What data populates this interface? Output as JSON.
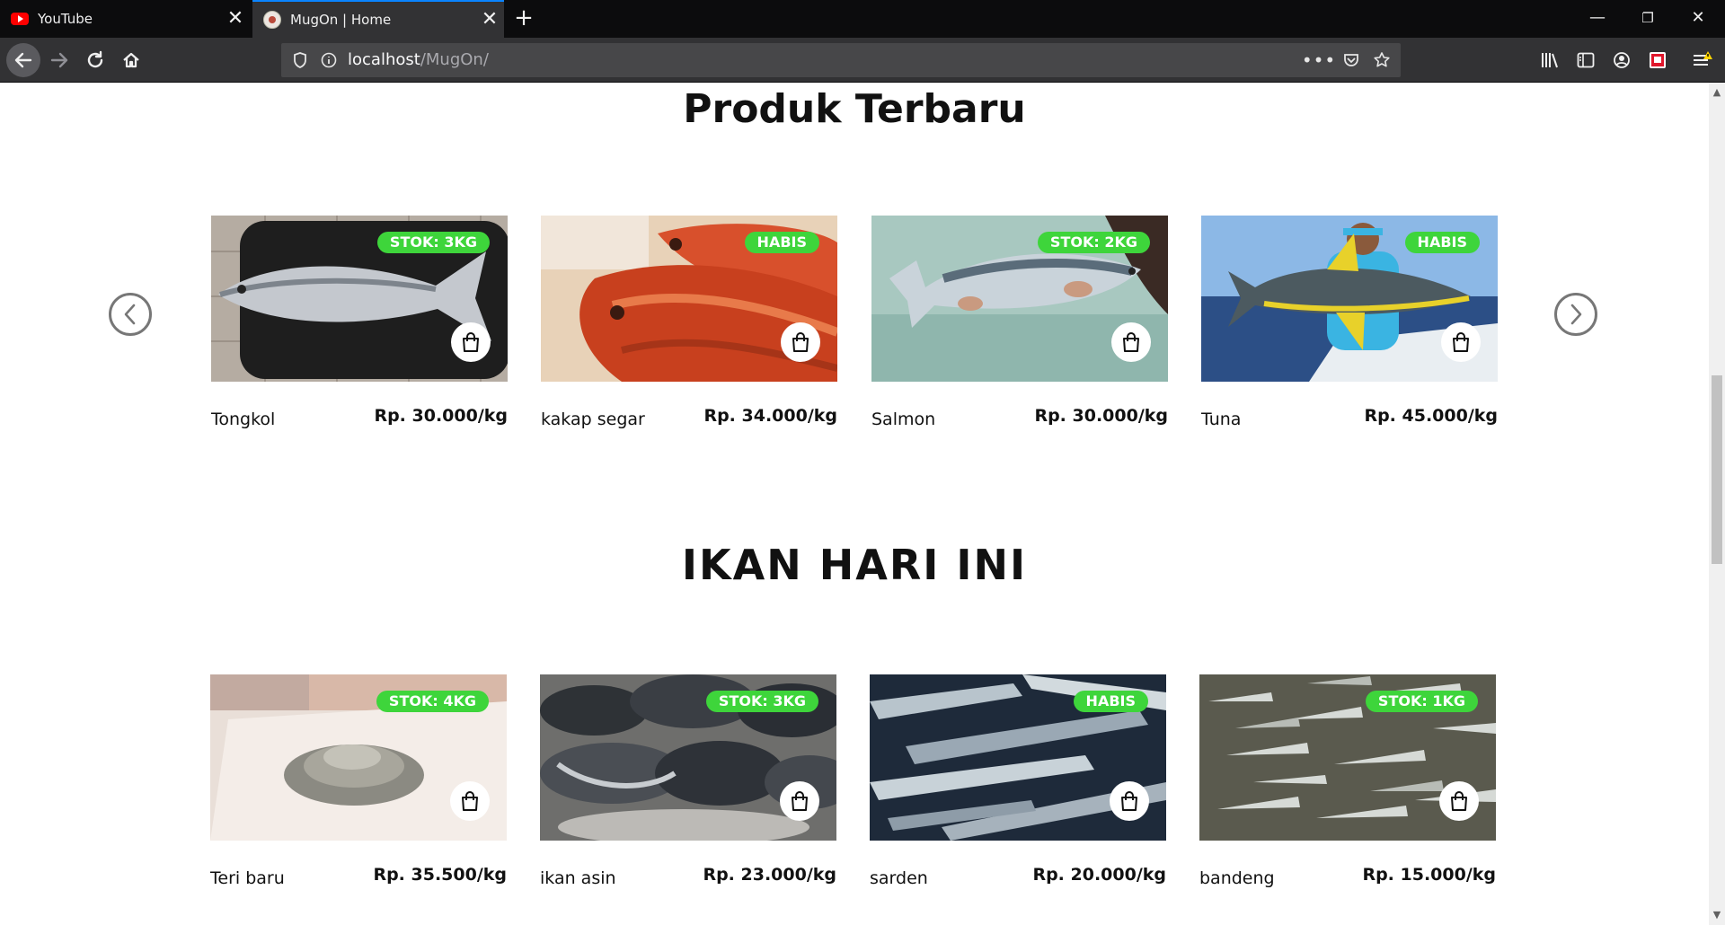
{
  "browser": {
    "tabs": [
      {
        "title": "YouTube"
      },
      {
        "title": "MugOn | Home"
      }
    ],
    "url_host": "localhost",
    "url_path": "/MugOn/"
  },
  "sections": [
    {
      "title": "Produk Terbaru",
      "products": [
        {
          "name": "Tongkol",
          "price": "Rp. 30.000/kg",
          "badge": "STOK: 3KG"
        },
        {
          "name": "kakap segar",
          "price": "Rp. 34.000/kg",
          "badge": "HABIS"
        },
        {
          "name": "Salmon",
          "price": "Rp. 30.000/kg",
          "badge": "STOK: 2KG"
        },
        {
          "name": "Tuna",
          "price": "Rp. 45.000/kg",
          "badge": "HABIS"
        }
      ]
    },
    {
      "title": "IKAN HARI INI",
      "products": [
        {
          "name": "Teri baru",
          "price": "Rp. 35.500/kg",
          "badge": "STOK: 4KG"
        },
        {
          "name": "ikan asin",
          "price": "Rp. 23.000/kg",
          "badge": "STOK: 3KG"
        },
        {
          "name": "sarden",
          "price": "Rp. 20.000/kg",
          "badge": "HABIS"
        },
        {
          "name": "bandeng",
          "price": "Rp. 15.000/kg",
          "badge": "STOK: 1KG"
        }
      ]
    }
  ],
  "colors": {
    "badge": "#3ed53b",
    "chrome_dark": "#0c0c0d",
    "chrome_toolbar": "#323234",
    "active_tab_accent": "#0a84ff"
  }
}
